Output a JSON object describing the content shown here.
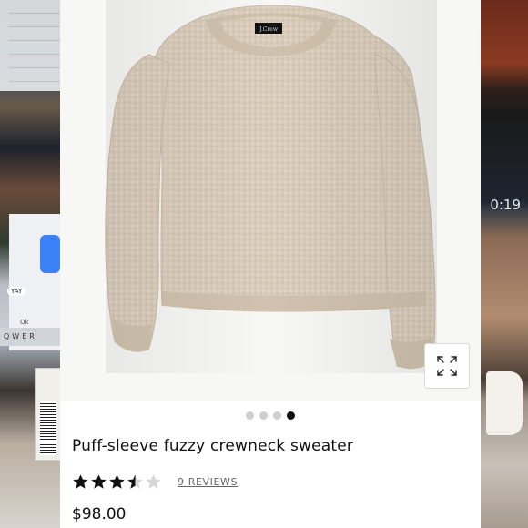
{
  "background": {
    "left_keys": "QWER",
    "left_reaction": "YAY",
    "left_ok": "Ok",
    "right_video_time": "0:19"
  },
  "product": {
    "brand_label": "J.Crew",
    "title": "Puff-sleeve fuzzy crewneck sweater",
    "rating": 3.5,
    "rating_max": 5,
    "reviews_label": "9 REVIEWS",
    "price": "$98.00",
    "image_count": 4,
    "active_image_index": 3,
    "sweater_color": "#d9ccbb"
  },
  "icons": {
    "expand": "expand-arrows-icon",
    "star": "star-icon"
  }
}
